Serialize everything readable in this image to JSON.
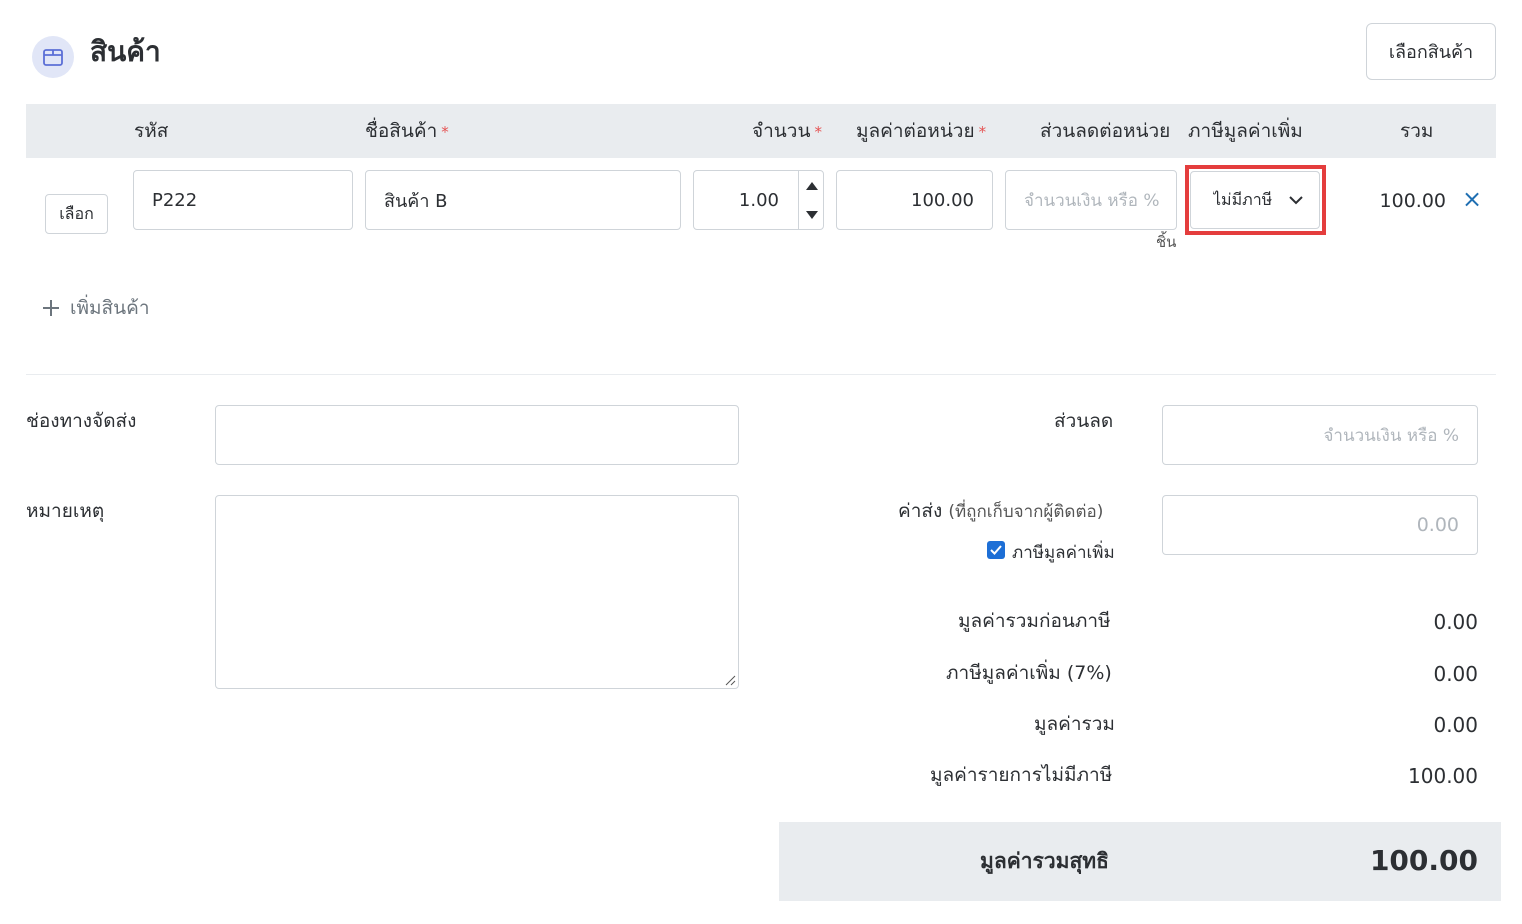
{
  "header": {
    "title": "สินค้า",
    "select_product_button": "เลือกสินค้า"
  },
  "table": {
    "columns": {
      "code": "รหัส",
      "name": "ชื่อสินค้า",
      "qty": "จำนวน",
      "unit_price": "มูลค่าต่อหน่วย",
      "discount": "ส่วนลดต่อหน่วย",
      "vat": "ภาษีมูลค่าเพิ่ม",
      "total": "รวม"
    },
    "required_mark": "*",
    "row": {
      "pick_button": "เลือก",
      "code": "P222",
      "name": "สินค้า B",
      "qty": "1.00",
      "unit_price": "100.00",
      "discount_placeholder": "จำนวนเงิน หรือ %",
      "unit": "ชิ้น",
      "vat_selected": "ไม่มีภาษี",
      "total": "100.00",
      "remove": "×"
    },
    "add_product": "เพิ่มสินค้า"
  },
  "form": {
    "shipping_channel_label": "ช่องทางจัดส่ง",
    "note_label": "หมายเหตุ",
    "discount_label": "ส่วนลด",
    "discount_placeholder": "จำนวนเงิน หรือ %",
    "shipping_fee_label": "ค่าส่ง",
    "shipping_fee_sub": "(ที่ถูกเก็บจากผู้ติดต่อ)",
    "shipping_fee_placeholder": "0.00",
    "shipping_vat_checkbox_label": "ภาษีมูลค่าเพิ่ม",
    "shipping_vat_checked": true
  },
  "summary": {
    "subtotal_label": "มูลค่ารวมก่อนภาษี",
    "subtotal": "0.00",
    "vat_label": "ภาษีมูลค่าเพิ่ม (7%)",
    "vat": "0.00",
    "total_label": "มูลค่ารวม",
    "total": "0.00",
    "non_vat_label": "มูลค่ารายการไม่มีภาษี",
    "non_vat": "100.00",
    "net_label": "มูลค่ารวมสุทธิ",
    "net": "100.00"
  },
  "colors": {
    "highlight": "#e43d3d",
    "accent": "#1f6fb2",
    "header_bg": "#e9ecef"
  }
}
